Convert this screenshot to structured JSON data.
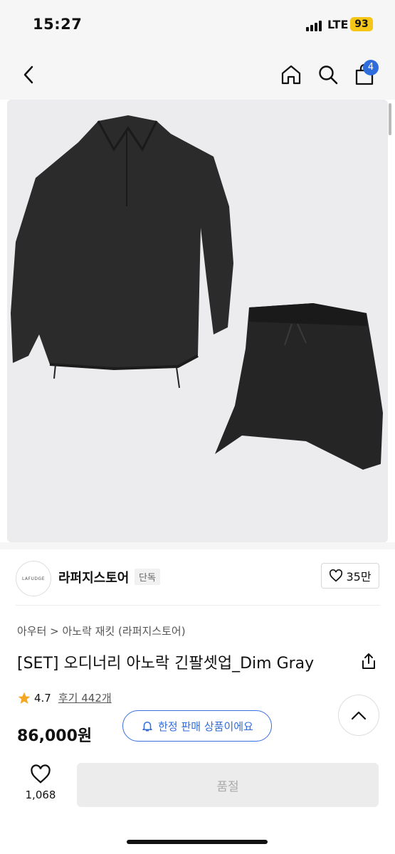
{
  "status": {
    "time": "15:27",
    "network": "LTE",
    "battery": "93"
  },
  "nav": {
    "cart_count": "4"
  },
  "store": {
    "logo_text": "LAFUDGE",
    "name": "라퍼지스토어",
    "tag": "단독",
    "likes": "35만"
  },
  "product": {
    "breadcrumb": "아우터 > 아노락 재킷 (라퍼지스토어)",
    "title": "[SET] 오디너리 아노락 긴팔셋업_Dim Gray",
    "rating": "4.7",
    "reviews": "후기 442개",
    "price": "86,000원",
    "limited_label": "한정 판매 상품이에요"
  },
  "actions": {
    "wish_count": "1,068",
    "soldout_label": "품절"
  },
  "colors": {
    "accent": "#2f6ddc",
    "star": "#f5a623"
  }
}
